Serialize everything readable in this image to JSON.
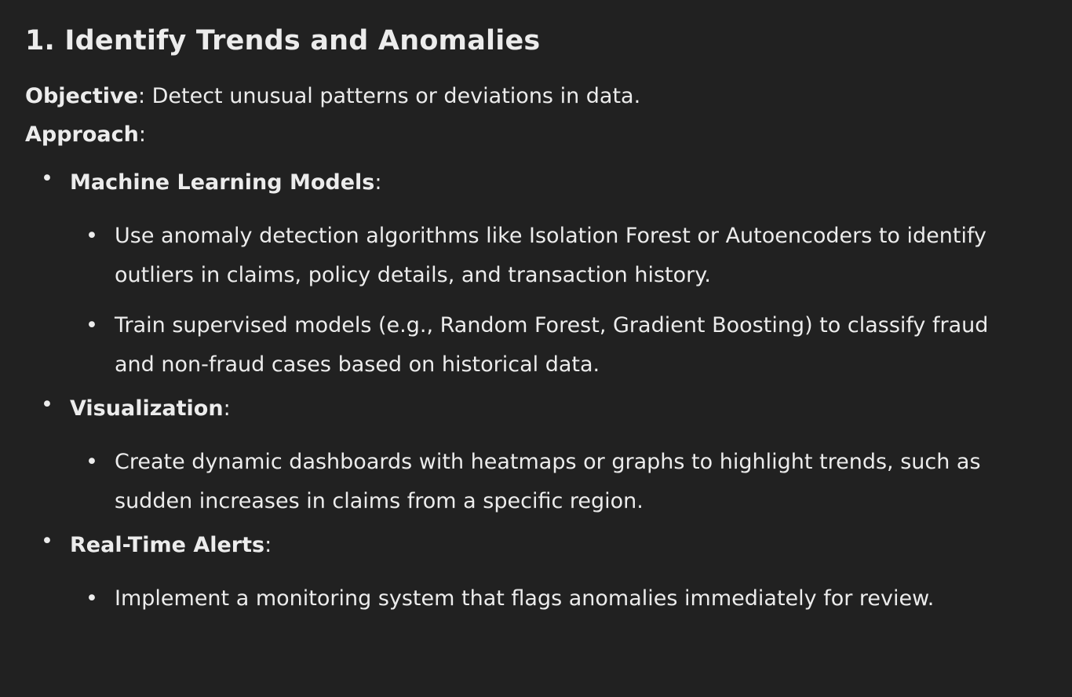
{
  "heading": "1. Identify Trends and Anomalies",
  "objective": {
    "label": "Objective",
    "text": ": Detect unusual patterns or deviations in data."
  },
  "approach": {
    "label": "Approach",
    "text": ":"
  },
  "sections": [
    {
      "title": "Machine Learning Models",
      "suffix": ":",
      "items": [
        "Use anomaly detection algorithms like Isolation Forest or Autoencoders to identify outliers in claims, policy details, and transaction history.",
        "Train supervised models (e.g., Random Forest, Gradient Boosting) to classify fraud and non-fraud cases based on historical data."
      ]
    },
    {
      "title": "Visualization",
      "suffix": ":",
      "items": [
        "Create dynamic dashboards with heatmaps or graphs to highlight trends, such as sudden increases in claims from a specific region."
      ]
    },
    {
      "title": "Real-Time Alerts",
      "suffix": ":",
      "items": [
        "Implement a monitoring system that flags anomalies immediately for review."
      ]
    }
  ],
  "bullet_char": "•"
}
